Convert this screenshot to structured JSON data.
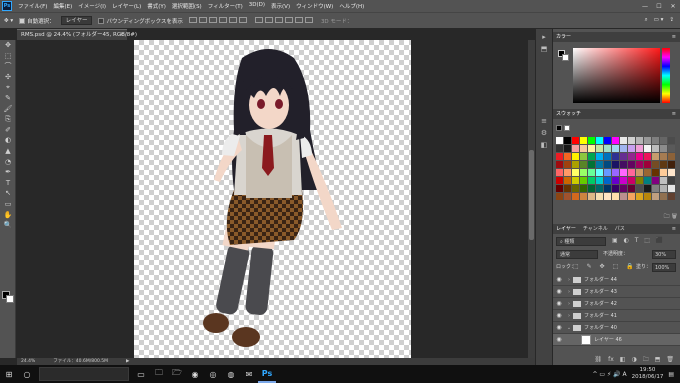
{
  "app": {
    "logo": "Ps"
  },
  "menu": [
    "ファイル(F)",
    "編集(E)",
    "イメージ(I)",
    "レイヤー(L)",
    "書式(Y)",
    "選択範囲(S)",
    "フィルター(T)",
    "3D(D)",
    "表示(V)",
    "ウィンドウ(W)",
    "ヘルプ(H)"
  ],
  "window_controls": [
    "—",
    "☐",
    "✕"
  ],
  "options": {
    "auto_select_label": "自動選択：",
    "layer_select": "レイヤー",
    "bounding_box_label": "バウンディングボックスを表示",
    "mode_3d": "3D モード："
  },
  "document": {
    "tab_title": "RMS.psd @ 24.4% (フォルダー45, RGB/8#)",
    "close": "×"
  },
  "status": {
    "zoom": "24.4%",
    "file_info": "ファイル：40.6M/800.5M",
    "arrow": "▶"
  },
  "tools": [
    "✥",
    "⬚",
    "⌒",
    "✣",
    "⌖",
    "✎",
    "🖌",
    "⎘",
    "✐",
    "◐",
    "▲",
    "◔",
    "✒",
    "T",
    "↖",
    "▭",
    "✋",
    "🔍"
  ],
  "dock_icons": [
    "▸",
    "⬒",
    "≡",
    "⚙",
    "◧"
  ],
  "color_panel": {
    "tab": "カラー",
    "menu": "≡"
  },
  "swatch_panel": {
    "tab": "スウォッチ",
    "menu": "≡",
    "footer_icons": "🗀 🗑"
  },
  "swatch_top_colors": [
    "#000000",
    "#ffffff"
  ],
  "swatches": [
    "#ffffff",
    "#000000",
    "#ff0000",
    "#ffff00",
    "#00ff00",
    "#00ffff",
    "#0000ff",
    "#ff00ff",
    "#e8e8e8",
    "#d0d0d0",
    "#b4b4b4",
    "#999999",
    "#7f7f7f",
    "#666666",
    "#4c4c4c",
    "#333333",
    "#1a1a1a",
    "#f4a0a0",
    "#f7c99c",
    "#fff5a0",
    "#c8e6a0",
    "#a0e0c8",
    "#a0d8f0",
    "#a0b4f0",
    "#c8a0f0",
    "#f0a0d8",
    "#f5f5f5",
    "#bdbdbd",
    "#8c8c8c",
    "#5a5a5a",
    "#ec1c24",
    "#f26522",
    "#fff200",
    "#8dc63f",
    "#00a651",
    "#00aeef",
    "#0072bc",
    "#2e3192",
    "#662d91",
    "#92278f",
    "#ec008c",
    "#ed145b",
    "#c69c6d",
    "#a67c52",
    "#8c6239",
    "#9e0b0f",
    "#a0410d",
    "#aba000",
    "#598527",
    "#007236",
    "#0076a3",
    "#004a80",
    "#1b1464",
    "#440e62",
    "#630460",
    "#9e005d",
    "#9e0039",
    "#754c24",
    "#603913",
    "#42210b",
    "#ff6666",
    "#ff9966",
    "#ffff66",
    "#99ff66",
    "#66ff99",
    "#66ffff",
    "#6699ff",
    "#9966ff",
    "#ff66ff",
    "#ff6699",
    "#cc9966",
    "#996633",
    "#663300",
    "#ffcc99",
    "#ffe6cc",
    "#cc0000",
    "#cc6600",
    "#cccc00",
    "#66cc00",
    "#00cc66",
    "#00cccc",
    "#0066cc",
    "#6600cc",
    "#cc00cc",
    "#cc0066",
    "#808000",
    "#008080",
    "#800080",
    "#c0c0c0",
    "#404040",
    "#660000",
    "#663300",
    "#666600",
    "#336600",
    "#006633",
    "#006666",
    "#003366",
    "#330066",
    "#660066",
    "#660033",
    "#4d4d4d",
    "#1a1a1a",
    "#808080",
    "#b3b3b3",
    "#e6e6e6",
    "#8b4513",
    "#a0522d",
    "#d2691e",
    "#cd853f",
    "#deb887",
    "#f5deb3",
    "#ffe4c4",
    "#ffdead",
    "#bc8f8f",
    "#f4a460",
    "#daa520",
    "#b8860b",
    "#c0a080",
    "#907050",
    "#604030"
  ],
  "layers_panel": {
    "tabs": [
      "レイヤー",
      "チャンネル",
      "パス"
    ],
    "menu": "≡",
    "filter": "⌕ 種類",
    "filter_icons": "▣ ◐ T ⬚ ⬛",
    "blend_mode": "通常",
    "opacity_label": "不透明度：",
    "opacity": "30%",
    "lock_label": "ロック：",
    "lock_icons": "⬚ ✎ ✥ ⬚ 🔒",
    "fill_label": "塗り：",
    "fill": "100%",
    "footer_icons": [
      "⛓",
      "fx",
      "◧",
      "◑",
      "🗀",
      "⬒",
      "🗑"
    ]
  },
  "layers": [
    {
      "name": "フォルダー 44",
      "type": "folder",
      "expanded": false,
      "indent": 0
    },
    {
      "name": "フォルダー 43",
      "type": "folder",
      "expanded": false,
      "indent": 0
    },
    {
      "name": "フォルダー 42",
      "type": "folder",
      "expanded": false,
      "indent": 0
    },
    {
      "name": "フォルダー 41",
      "type": "folder",
      "expanded": false,
      "indent": 0
    },
    {
      "name": "フォルダー 40",
      "type": "folder",
      "expanded": true,
      "indent": 0
    },
    {
      "name": "レイヤー 46",
      "type": "layer",
      "expanded": false,
      "indent": 1
    }
  ],
  "taskbar": {
    "start": "⊞",
    "search": "○",
    "task_view": "▭",
    "apps": [
      "🗀",
      "🗁",
      "◉",
      "◎",
      "◍",
      "✉",
      "Ps"
    ],
    "tray_icons": "^ ▭ ⚡ 🔊 A",
    "time": "19:50",
    "date": "2018/06/17",
    "notify": "▤"
  }
}
